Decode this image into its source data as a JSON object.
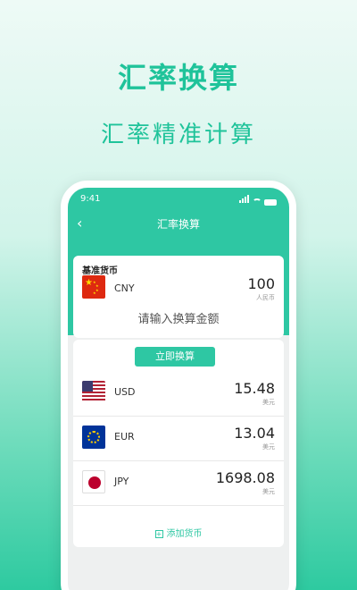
{
  "promo": {
    "title": "汇率换算",
    "subtitle": "汇率精准计算"
  },
  "status_bar": {
    "time": "9:41"
  },
  "nav": {
    "title": "汇率换算"
  },
  "base": {
    "label": "基准货币",
    "code": "CNY",
    "amount": "100",
    "unit": "人民币",
    "placeholder": "请输入换算金额"
  },
  "convert_button": "立即换算",
  "currencies": [
    {
      "code": "USD",
      "amount": "15.48",
      "unit": "美元",
      "flag": "us-flag"
    },
    {
      "code": "EUR",
      "amount": "13.04",
      "unit": "美元",
      "flag": "eu-flag"
    },
    {
      "code": "JPY",
      "amount": "1698.08",
      "unit": "美元",
      "flag": "jp-flag"
    }
  ],
  "add_currency": "添加货币",
  "colors": {
    "accent": "#2ec7a3",
    "title": "#1fc39a"
  }
}
